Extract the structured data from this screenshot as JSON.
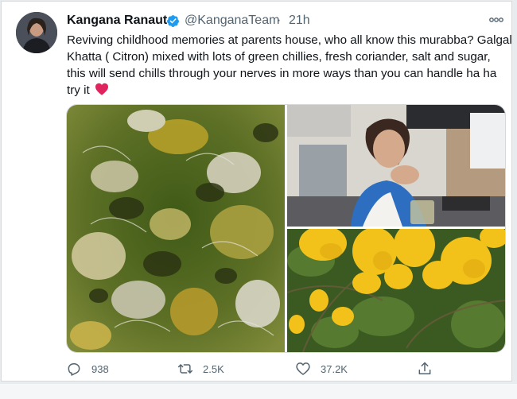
{
  "tweet": {
    "author_name": "Kangana Ranaut",
    "handle": "@KanganaTeam",
    "separator": "·",
    "time": "21h",
    "text": "Reviving childhood memories at parents house, who all know this murabba? Galgal Khatta ( Citron) mixed with lots of green chillies, fresh coriander, salt and sugar, this will send chills through your nerves in more ways than you can handle ha ha try it",
    "emoji": "red-heart"
  },
  "actions": {
    "replies": "938",
    "retweets": "2.5K",
    "likes": "37.2K"
  },
  "icons": {
    "verified": "verified-badge-icon",
    "more": "more-icon",
    "reply": "reply-icon",
    "retweet": "retweet-icon",
    "like": "like-icon",
    "share": "share-icon"
  },
  "colors": {
    "verified_blue": "#1d9bf0",
    "text": "#0f1419",
    "muted": "#536471",
    "heart": "#e0245e"
  }
}
